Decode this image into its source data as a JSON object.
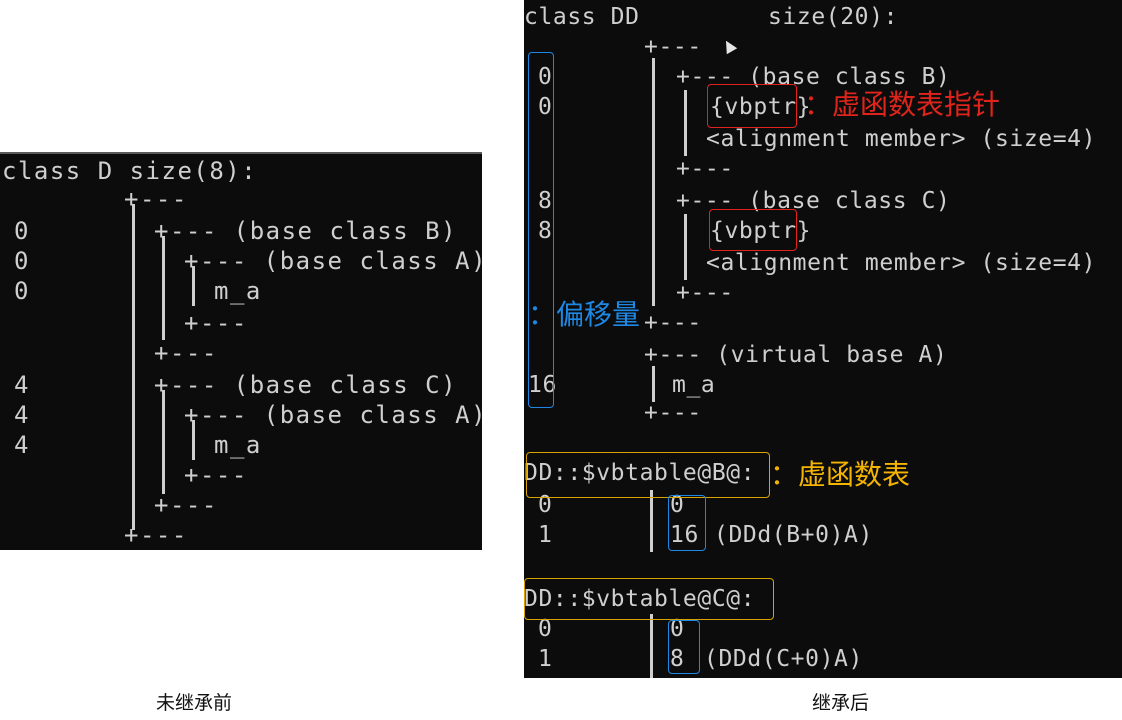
{
  "left_panel": {
    "caption": "未继承前",
    "header": "class D size(8):",
    "lines": [
      {
        "offset": "",
        "tree": "+---"
      },
      {
        "offset": "0",
        "tree": "+--- (base class B)"
      },
      {
        "offset": "0",
        "tree": "+--- (base class A)"
      },
      {
        "offset": "0",
        "tree": "m_a"
      },
      {
        "offset": "",
        "tree": "+---"
      },
      {
        "offset": "",
        "tree": "+---"
      },
      {
        "offset": "4",
        "tree": "+--- (base class C)"
      },
      {
        "offset": "4",
        "tree": "+--- (base class A)"
      },
      {
        "offset": "4",
        "tree": "m_a"
      },
      {
        "offset": "",
        "tree": "+---"
      },
      {
        "offset": "",
        "tree": "+---"
      },
      {
        "offset": "",
        "tree": "+---"
      }
    ]
  },
  "right_panel": {
    "caption": "继承后",
    "header_class": "class DD",
    "header_size": "size(20):",
    "lines": [
      {
        "offset": "",
        "tree": "+---"
      },
      {
        "offset": "0",
        "tree": "+--- (base class B)"
      },
      {
        "offset": "0",
        "tree": "{vbptr}"
      },
      {
        "offset": "",
        "tree": "<alignment member> (size=4)"
      },
      {
        "offset": "",
        "tree": "+---"
      },
      {
        "offset": "8",
        "tree": "+--- (base class C)"
      },
      {
        "offset": "8",
        "tree": "{vbptr}"
      },
      {
        "offset": "",
        "tree": "<alignment member> (size=4)"
      },
      {
        "offset": "",
        "tree": "+---"
      },
      {
        "offset": "",
        "tree": "+---"
      },
      {
        "offset": "",
        "tree": "+--- (virtual base A)"
      },
      {
        "offset": "16",
        "tree": "m_a"
      },
      {
        "offset": "",
        "tree": "+---"
      }
    ],
    "vbtables": [
      {
        "title": "DD::$vbtable@B@:",
        "rows": [
          {
            "index": "0",
            "value": "0",
            "note": ""
          },
          {
            "index": "1",
            "value": "16",
            "note": "(DDd(B+0)A)"
          }
        ]
      },
      {
        "title": "DD::$vbtable@C@:",
        "rows": [
          {
            "index": "0",
            "value": "0",
            "note": ""
          },
          {
            "index": "1",
            "value": "8",
            "note": "(DDd(C+0)A)"
          }
        ]
      }
    ]
  },
  "annotations": {
    "vbptr_label": "：虚函数表指针",
    "offset_label": "：偏移量",
    "vbtable_label": "：虚函数表",
    "colors": {
      "red": "#e0241b",
      "blue": "#1e88e5",
      "yellow": "#f5b400"
    }
  }
}
